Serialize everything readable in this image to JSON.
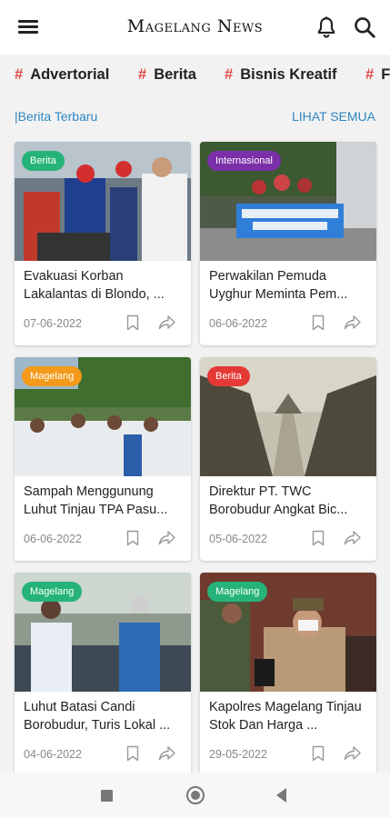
{
  "app": {
    "title": "Magelang News"
  },
  "categories": [
    {
      "label": "Advertorial"
    },
    {
      "label": "Berita"
    },
    {
      "label": "Bisnis Kreatif"
    },
    {
      "label": "F"
    }
  ],
  "section": {
    "title": "|Berita Terbaru",
    "see_all": "LIHAT SEMUA"
  },
  "colors": {
    "accent": "#2e86c1",
    "hash": "#e04a4a"
  },
  "articles": [
    {
      "badge": "Berita",
      "badge_color": "#26b37a",
      "title": "Evakuasi Korban Lakalantas di Blondo, ...",
      "date": "07-06-2022"
    },
    {
      "badge": "Internasional",
      "badge_color": "#7b2fa8",
      "title": "Perwakilan Pemuda Uyghur Meminta Pem...",
      "date": "06-06-2022"
    },
    {
      "badge": "Magelang",
      "badge_color": "#f39a1b",
      "title": "Sampah Menggunung Luhut Tinjau TPA Pasu...",
      "date": "06-06-2022"
    },
    {
      "badge": "Berita",
      "badge_color": "#e53935",
      "title": "Direktur PT. TWC Borobudur Angkat Bic...",
      "date": "05-06-2022"
    },
    {
      "badge": "Magelang",
      "badge_color": "#26b37a",
      "title": "Luhut Batasi Candi Borobudur, Turis Lokal ...",
      "date": "04-06-2022"
    },
    {
      "badge": "Magelang",
      "badge_color": "#26b37a",
      "title": "Kapolres Magelang Tinjau Stok Dan Harga ...",
      "date": "29-05-2022"
    }
  ]
}
